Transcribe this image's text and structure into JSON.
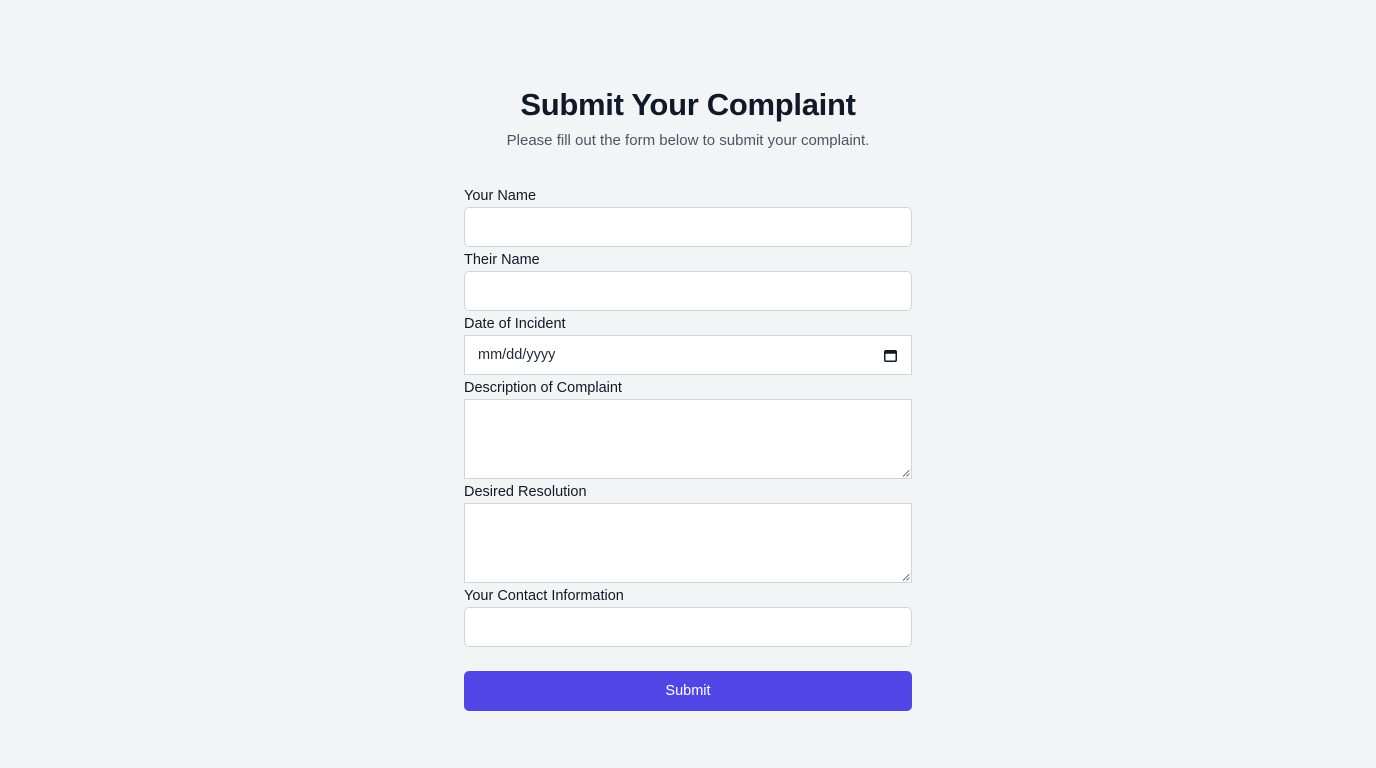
{
  "header": {
    "title": "Submit Your Complaint",
    "subtitle": "Please fill out the form below to submit your complaint."
  },
  "form": {
    "your_name": {
      "label": "Your Name",
      "value": ""
    },
    "their_name": {
      "label": "Their Name",
      "value": ""
    },
    "date_of_incident": {
      "label": "Date of Incident",
      "placeholder": "mm/dd/yyyy",
      "icon": "calendar-icon"
    },
    "description": {
      "label": "Description of Complaint",
      "value": ""
    },
    "desired_resolution": {
      "label": "Desired Resolution",
      "value": ""
    },
    "contact_info": {
      "label": "Your Contact Information",
      "value": ""
    },
    "submit_label": "Submit"
  },
  "colors": {
    "background": "#f3f4f6",
    "accent": "#4f46e5",
    "border": "#d1d5db",
    "text": "#111827",
    "muted_text": "#4b5563"
  }
}
